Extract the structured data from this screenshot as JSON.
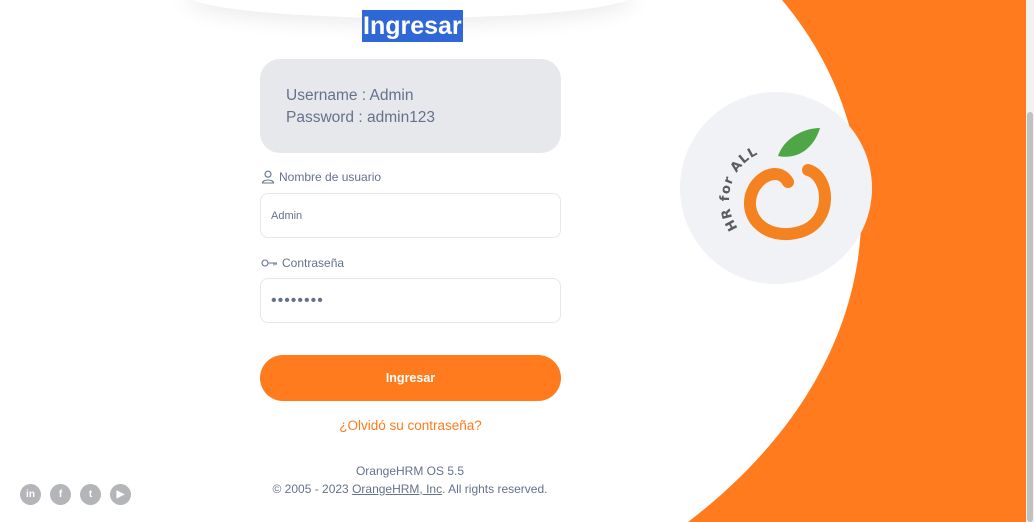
{
  "login": {
    "title": "Ingresar",
    "credentials": {
      "username_line": "Username : Admin",
      "password_line": "Password : admin123"
    },
    "username": {
      "label": "Nombre de usuario",
      "value": "Admin",
      "icon": "user-icon"
    },
    "password": {
      "label": "Contraseña",
      "value": "admin123",
      "icon": "key-icon"
    },
    "submit_label": "Ingresar",
    "forgot_label": "¿Olvidó su contraseña?"
  },
  "footer": {
    "version": "OrangeHRM OS 5.5",
    "copyright_prefix": "© 2005 - 2023 ",
    "company_link": "OrangeHRM, Inc",
    "copyright_suffix": ". All rights reserved."
  },
  "socials": [
    {
      "icon": "linkedin-icon",
      "glyph": "in"
    },
    {
      "icon": "facebook-icon",
      "glyph": "f"
    },
    {
      "icon": "twitter-icon",
      "glyph": "t"
    },
    {
      "icon": "youtube-icon",
      "glyph": "▶"
    }
  ],
  "branding": {
    "logo_text": "HR for ALL"
  },
  "colors": {
    "accent": "#ff7b1d",
    "text_muted": "#64728c",
    "cred_box": "#e7e8ec",
    "title_highlight": "#2f67d6"
  }
}
